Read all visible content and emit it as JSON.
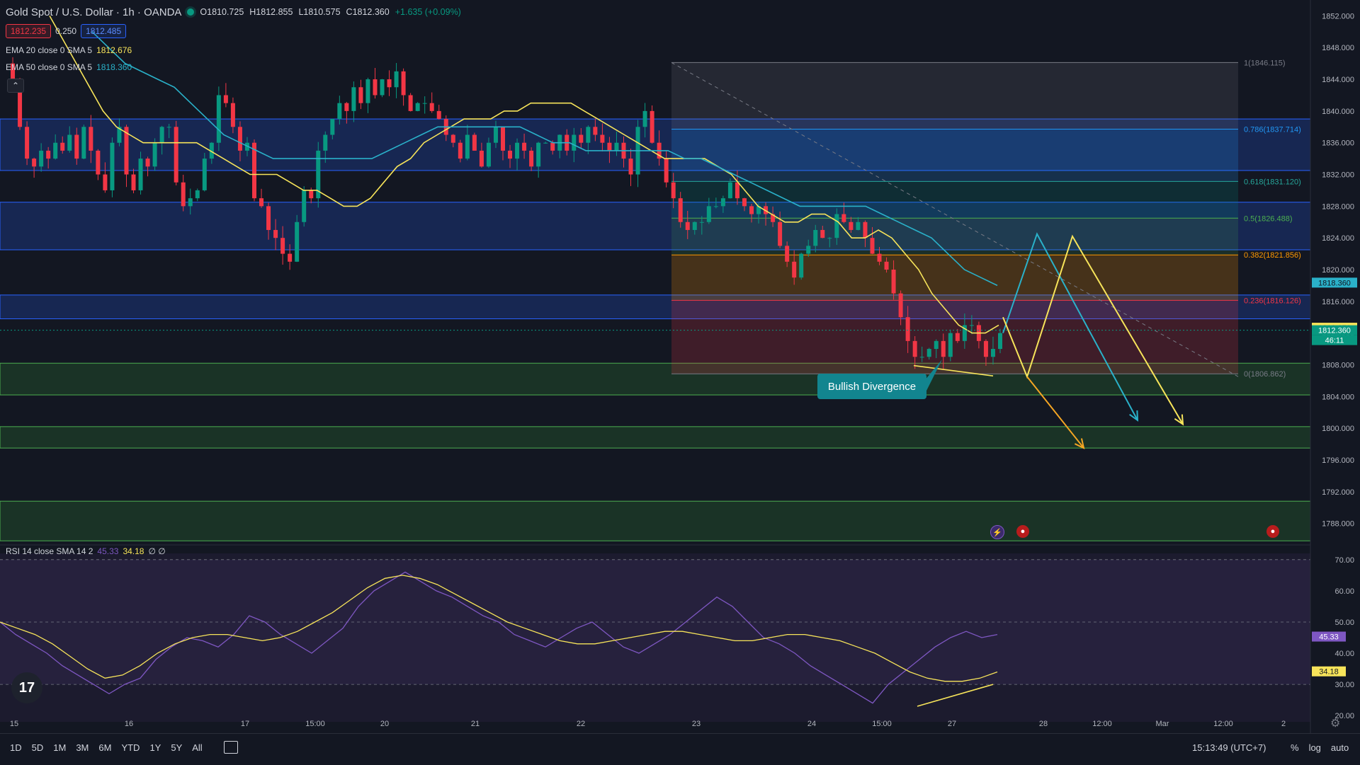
{
  "header": {
    "symbol": "Gold Spot / U.S. Dollar · 1h · OANDA",
    "open": "O1810.725",
    "high": "H1812.855",
    "low": "L1810.575",
    "close": "C1812.360",
    "change": "+1.635 (+0.09%)",
    "bid": "1812.235",
    "spread": "0.250",
    "ask": "1812.485"
  },
  "indicators": {
    "ema20": {
      "label": "EMA 20 close 0 SMA 5",
      "value": "1812.676",
      "color": "#f7e45a"
    },
    "ema50": {
      "label": "EMA 50 close 0 SMA 5",
      "value": "1818.360",
      "color": "#2ab1c9"
    },
    "rsi": {
      "label": "RSI 14 close SMA 14 2",
      "value1": "45.33",
      "value2": "34.18",
      "tail": "∅ ∅"
    }
  },
  "price_axis": {
    "ticks": [
      "1852.000",
      "1848.000",
      "1844.000",
      "1840.000",
      "1836.000",
      "1832.000",
      "1828.000",
      "1824.000",
      "1820.000",
      "1816.000",
      "1812.000",
      "1808.000",
      "1804.000",
      "1800.000",
      "1796.000",
      "1792.000",
      "1788.000"
    ],
    "badges": [
      {
        "text": "1818.360",
        "bg": "#2ab1c9",
        "fg": "#131722"
      },
      {
        "text": "1812.676",
        "bg": "#f7e45a",
        "fg": "#131722"
      },
      {
        "text": "1812.360",
        "bg": "#089981",
        "fg": "#ffffff"
      },
      {
        "text": "46:11",
        "bg": "#089981",
        "fg": "#ffffff"
      }
    ]
  },
  "rsi_axis": {
    "ticks": [
      "70.00",
      "60.00",
      "50.00",
      "40.00",
      "30.00",
      "20.00"
    ],
    "badges": [
      {
        "text": "45.33",
        "bg": "#7e57c2",
        "fg": "#ffffff"
      },
      {
        "text": "34.18",
        "bg": "#f7e45a",
        "fg": "#131722"
      }
    ]
  },
  "time_axis": [
    "15",
    "16",
    "17",
    "15:00",
    "20",
    "21",
    "22",
    "23",
    "24",
    "15:00",
    "27",
    "28",
    "12:00",
    "Mar",
    "12:00",
    "2"
  ],
  "fib_labels": [
    "1(1846.115)",
    "0.786(1837.714)",
    "0.618(1831.120)",
    "0.5(1826.488)",
    "0.382(1821.856)",
    "0.236(1816.126)",
    "0(1806.862)"
  ],
  "annotation": {
    "text": "Bullish Divergence"
  },
  "toolbar": {
    "timeframes": [
      "1D",
      "5D",
      "1M",
      "3M",
      "6M",
      "YTD",
      "1Y",
      "5Y",
      "All"
    ],
    "clock": "15:13:49 (UTC+7)",
    "options": [
      "%",
      "log",
      "auto"
    ]
  },
  "logo_text": "17",
  "icons": [
    "compare-icon",
    "gear-icon",
    "tradingview-logo-icon",
    "collapse-chevron-icon",
    "lightning-event-icon",
    "us-flag-event-icon"
  ],
  "colors": {
    "up": "#089981",
    "down": "#f23645",
    "ema20": "#f7e45a",
    "ema50": "#2ab1c9",
    "rsi": "#7e57c2",
    "projection_orange": "#f5a623"
  },
  "chart_data": {
    "type": "candlestick",
    "symbol": "XAUUSD",
    "timeframe": "1h",
    "ylim": [
      1786,
      1854
    ],
    "rsi_ylim": [
      18,
      72
    ],
    "close_path": [
      1846,
      1844,
      1838,
      1834,
      1833,
      1835,
      1834,
      1836,
      1835,
      1837,
      1834,
      1838,
      1835,
      1832,
      1830,
      1836,
      1838,
      1832,
      1830,
      1834,
      1833,
      1836,
      1838,
      1838,
      1831,
      1828,
      1829,
      1830,
      1834,
      1836,
      1842,
      1841,
      1838,
      1835,
      1836,
      1829,
      1828,
      1825,
      1824,
      1822,
      1821,
      1826,
      1830,
      1829,
      1835,
      1837,
      1839,
      1841,
      1840,
      1843,
      1841,
      1844,
      1842,
      1844,
      1843,
      1845,
      1842,
      1840,
      1841,
      1841,
      1840,
      1839,
      1837,
      1836,
      1834,
      1837,
      1835,
      1833,
      1836,
      1838,
      1835,
      1834,
      1836,
      1835,
      1833,
      1836,
      1836,
      1835,
      1837,
      1835,
      1837,
      1836,
      1838,
      1837,
      1836,
      1835,
      1836,
      1834,
      1832,
      1838,
      1840,
      1836,
      1834,
      1831,
      1829,
      1826,
      1825,
      1826,
      1826,
      1828,
      1828,
      1829,
      1831,
      1829,
      1828,
      1827,
      1828,
      1827,
      1826,
      1823,
      1821,
      1819,
      1822,
      1823,
      1825,
      1824,
      1824,
      1827,
      1826,
      1825,
      1826,
      1824,
      1822,
      1821,
      1820,
      1817,
      1814,
      1811,
      1809,
      1809,
      1810,
      1811,
      1809,
      1812,
      1811,
      1813,
      1813,
      1811,
      1809,
      1810,
      1812
    ],
    "ema20_path": [
      1852,
      1849,
      1846,
      1843,
      1840,
      1838,
      1837,
      1836,
      1836,
      1836,
      1836,
      1836,
      1835,
      1834,
      1833,
      1832,
      1832,
      1832,
      1831,
      1830,
      1830,
      1829,
      1828,
      1828,
      1829,
      1831,
      1833,
      1834,
      1836,
      1837,
      1838,
      1839,
      1839,
      1839,
      1840,
      1840,
      1841,
      1841,
      1841,
      1841,
      1840,
      1839,
      1838,
      1837,
      1836,
      1835,
      1834,
      1834,
      1834,
      1834,
      1833,
      1832,
      1830,
      1828,
      1827,
      1826,
      1826,
      1827,
      1827,
      1826,
      1824,
      1824,
      1825,
      1824,
      1822,
      1820,
      1817,
      1815,
      1813,
      1812,
      1812,
      1813
    ],
    "ema50_path": [
      1850,
      1848,
      1846,
      1845,
      1844,
      1843,
      1841,
      1839,
      1837,
      1836,
      1835,
      1834,
      1834,
      1834,
      1834,
      1834,
      1834,
      1834,
      1835,
      1836,
      1837,
      1838,
      1838,
      1838,
      1838,
      1838,
      1838,
      1837,
      1836,
      1836,
      1835,
      1835,
      1835,
      1835,
      1835,
      1835,
      1834,
      1834,
      1833,
      1832,
      1831,
      1830,
      1829,
      1828,
      1828,
      1828,
      1828,
      1828,
      1827,
      1826,
      1825,
      1824,
      1822,
      1820,
      1819,
      1818
    ],
    "rsi_path": [
      50,
      46,
      43,
      40,
      36,
      33,
      30,
      27,
      30,
      32,
      38,
      42,
      45,
      44,
      42,
      46,
      52,
      50,
      46,
      43,
      40,
      44,
      48,
      55,
      60,
      63,
      66,
      63,
      60,
      58,
      55,
      52,
      50,
      46,
      44,
      42,
      45,
      48,
      50,
      46,
      42,
      40,
      43,
      46,
      50,
      54,
      58,
      55,
      50,
      45,
      43,
      40,
      36,
      33,
      30,
      27,
      24,
      30,
      34,
      38,
      42,
      45,
      47,
      45,
      46
    ],
    "rsi_signal_path": [
      50,
      48,
      46,
      43,
      39,
      35,
      32,
      33,
      36,
      40,
      43,
      45,
      46,
      46,
      45,
      44,
      45,
      47,
      50,
      53,
      57,
      61,
      64,
      65,
      64,
      62,
      59,
      56,
      53,
      50,
      48,
      46,
      44,
      43,
      43,
      44,
      45,
      46,
      47,
      47,
      46,
      45,
      44,
      44,
      45,
      46,
      46,
      45,
      44,
      42,
      40,
      37,
      34,
      32,
      31,
      31,
      32,
      34
    ],
    "fibonacci": {
      "from": 1846.115,
      "to": 1806.862,
      "levels": [
        {
          "ratio": 1,
          "price": 1846.115
        },
        {
          "ratio": 0.786,
          "price": 1837.714
        },
        {
          "ratio": 0.618,
          "price": 1831.12
        },
        {
          "ratio": 0.5,
          "price": 1826.488
        },
        {
          "ratio": 0.382,
          "price": 1821.856
        },
        {
          "ratio": 0.236,
          "price": 1816.126
        },
        {
          "ratio": 0,
          "price": 1806.862
        }
      ]
    },
    "zones": [
      {
        "kind": "resistance",
        "from": 1832.5,
        "to": 1839.0
      },
      {
        "kind": "resistance",
        "from": 1822.5,
        "to": 1828.5
      },
      {
        "kind": "resistance",
        "from": 1813.8,
        "to": 1816.8
      },
      {
        "kind": "support",
        "from": 1804.2,
        "to": 1808.2
      },
      {
        "kind": "support",
        "from": 1797.5,
        "to": 1800.2
      },
      {
        "kind": "support",
        "from": 1785.8,
        "to": 1790.8
      }
    ],
    "projections": {
      "cyan_path": [
        1812,
        1824.5,
        1801
      ],
      "yellow_path": [
        1814,
        1806.5,
        1824.2,
        1800.5
      ],
      "orange_path": [
        1806.5,
        1797.5
      ]
    },
    "last_price": 1812.36
  }
}
